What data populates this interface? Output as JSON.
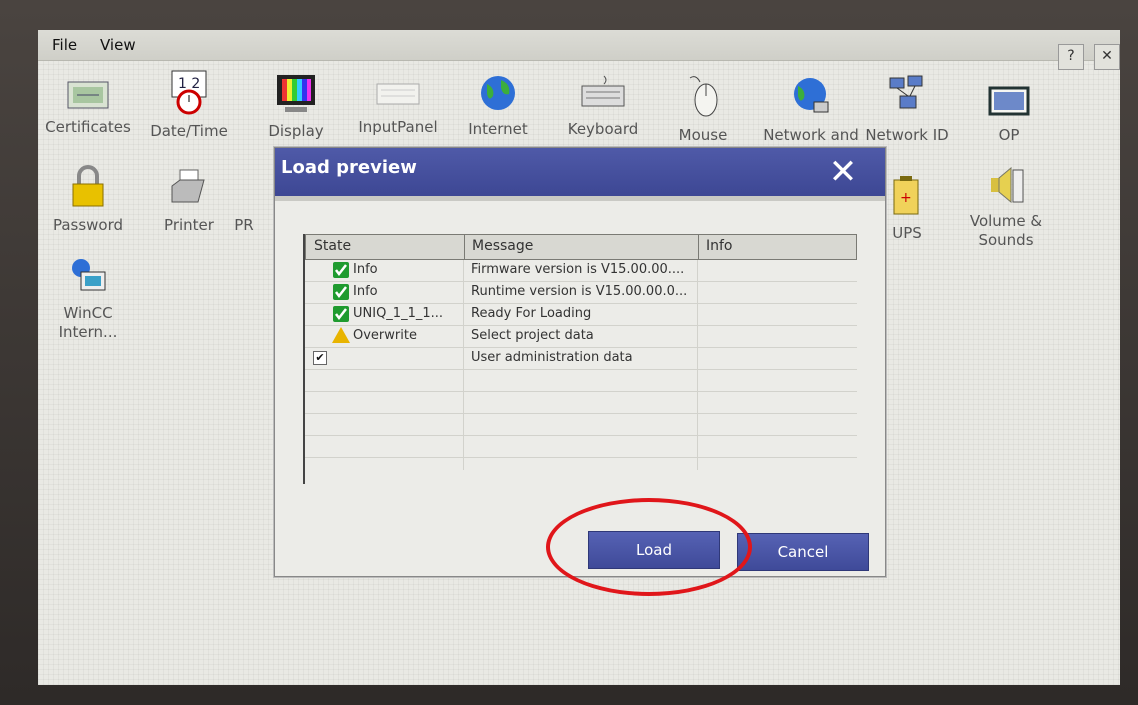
{
  "menubar": {
    "file": "File",
    "view": "View",
    "help_icon": "help-question-icon",
    "close_icon": "close-icon"
  },
  "desktop_icons": [
    {
      "label": "Certificates",
      "icon": "certificate-icon"
    },
    {
      "label": "Date/Time",
      "icon": "calendar-clock-icon"
    },
    {
      "label": "Display",
      "icon": "monitor-color-icon"
    },
    {
      "label": "InputPanel",
      "icon": "keyboard-panel-icon"
    },
    {
      "label": "Internet",
      "icon": "globe-icon"
    },
    {
      "label": "Keyboard",
      "icon": "keyboard-icon"
    },
    {
      "label": "Mouse",
      "icon": "mouse-icon"
    },
    {
      "label": "Network and",
      "icon": "network-globe-icon"
    },
    {
      "label": "Network ID",
      "icon": "network-id-icon"
    },
    {
      "label": "OP",
      "icon": "op-monitor-icon"
    },
    {
      "label": "Password",
      "icon": "lock-keys-icon"
    },
    {
      "label": "Printer",
      "icon": "printer-icon"
    },
    {
      "label": "PR",
      "icon": "profinet-icon"
    },
    {
      "label": "UPS",
      "icon": "ups-battery-icon"
    },
    {
      "label": "Volume & Sounds",
      "icon": "speaker-icon"
    },
    {
      "label": "WinCC Intern...",
      "icon": "wincc-globe-icon"
    }
  ],
  "dialog": {
    "title": "Load preview",
    "columns": [
      "State",
      "Message",
      "Info"
    ],
    "rows": [
      {
        "state_icon": "check-icon",
        "state": "Info",
        "message": "Firmware version is V15.00.00....",
        "info": ""
      },
      {
        "state_icon": "check-icon",
        "state": "Info",
        "message": "Runtime version is V15.00.00.0...",
        "info": ""
      },
      {
        "state_icon": "check-icon",
        "state": "UNIQ_1_1_1...",
        "message": "Ready For Loading",
        "info": ""
      },
      {
        "state_icon": "warning-icon",
        "state": "Overwrite",
        "message": "Select project data",
        "info": ""
      },
      {
        "state_icon": "checkbox-checked",
        "state": "",
        "message": "User administration data",
        "info": ""
      }
    ],
    "load_label": "Load",
    "cancel_label": "Cancel"
  },
  "colors": {
    "title_bar": "#3d4794",
    "button": "#4a55a8",
    "highlight": "#e0161a"
  }
}
